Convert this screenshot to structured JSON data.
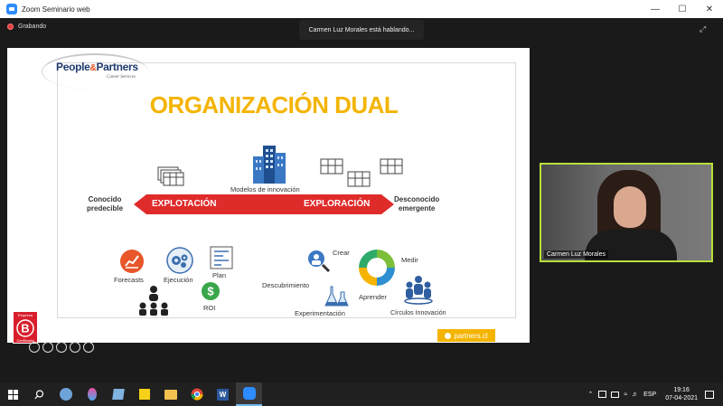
{
  "window": {
    "title": "Zoom Seminario web"
  },
  "meeting": {
    "recording_label": "Grabando",
    "speaking_label": "Carmen Luz Morales está hablando..."
  },
  "slide": {
    "logo_name_a": "People",
    "logo_amp": "&",
    "logo_name_b": "Partners",
    "logo_sub": "Career Services",
    "title": "ORGANIZACIÓN DUAL",
    "center_label": "Modelos de innovación",
    "left_label_1": "Conocido",
    "left_label_2": "predecible",
    "right_label_1": "Desconocido",
    "right_label_2": "emergente",
    "arrow_left": "EXPLOTACIÓN",
    "arrow_right": "EXPLORACIÓN",
    "left_items": [
      "Forecasts",
      "Ejecución",
      "Plan",
      "ROI"
    ],
    "right_items": [
      "Crear",
      "Medir",
      "Descubrimiento",
      "Aprender",
      "Experimentación",
      "Círculos Innovación"
    ],
    "badge_top": "Empresa",
    "badge_bottom": "Certificada",
    "partners_tag": "partners.cl"
  },
  "video": {
    "participant_name": "Carmen Luz Morales"
  },
  "taskbar": {
    "language": "ESP",
    "time": "19:16",
    "date": "07-04-2021"
  },
  "colors": {
    "accent_yellow": "#f4b400",
    "arrow_red": "#e02b2b",
    "zoom_blue": "#2d8cff",
    "speaker_frame": "#b7e03a"
  }
}
